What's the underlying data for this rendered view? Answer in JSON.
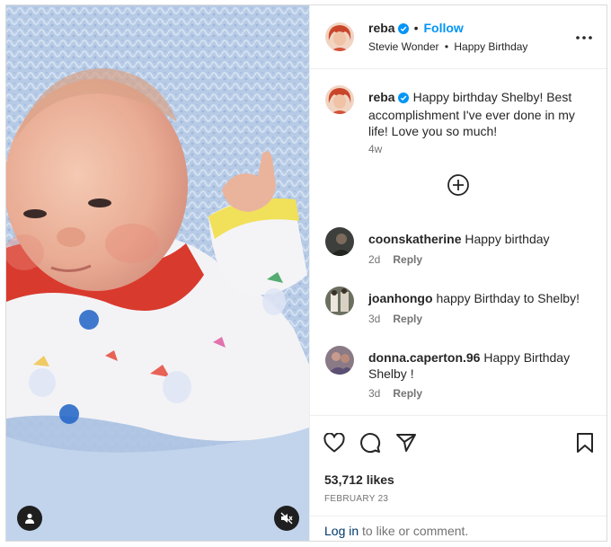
{
  "post": {
    "author": "reba",
    "follow_label": "Follow",
    "separator": "•",
    "audio": "Stevie Wonder",
    "audio_separator": "•",
    "location": "Happy Birthday",
    "caption_author": "reba",
    "caption": "Happy birthday Shelby! Best accomplishment I've ever done in my life! Love you so much!",
    "caption_age": "4w",
    "likes": "53,712 likes",
    "date": "FEBRUARY 23"
  },
  "comments": [
    {
      "user": "coonskatherine",
      "text": "Happy birthday",
      "age": "2d",
      "reply": "Reply"
    },
    {
      "user": "joanhongo",
      "text": "happy Birthday to Shelby!",
      "age": "3d",
      "reply": "Reply"
    },
    {
      "user": "donna.caperton.96",
      "text": "Happy Birthday Shelby !",
      "age": "3d",
      "reply": "Reply"
    }
  ],
  "login": {
    "link": "Log in",
    "rest": "to like or comment."
  },
  "icons": {
    "verified": "verified-badge-icon",
    "more": "more-options-icon",
    "load_more": "plus-circle-icon",
    "like": "heart-icon",
    "comment": "comment-icon",
    "share": "share-icon",
    "save": "bookmark-icon",
    "user_tag": "user-tag-icon",
    "mute": "muted-speaker-icon"
  },
  "colors": {
    "accent": "#0095f6",
    "verified": "#0095f6",
    "text": "#262626",
    "muted": "#737373",
    "link": "#00376b"
  }
}
